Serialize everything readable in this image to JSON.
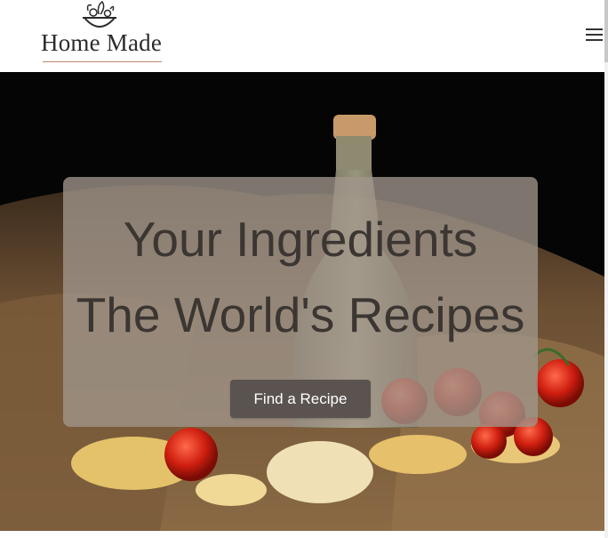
{
  "header": {
    "logo_text": "Home Made",
    "menu_icon": "hamburger-menu-icon"
  },
  "hero": {
    "headline_line1": "Your Ingredients",
    "headline_line2": "The World's Recipes",
    "cta_label": "Find a Recipe",
    "background_image": "olive oil bottle, tomatoes and pasta on burlap"
  },
  "colors": {
    "overlay": "#a0968c",
    "headline": "#3c3632",
    "button": "#5a5350",
    "logo_rule": "#b98a6a"
  }
}
